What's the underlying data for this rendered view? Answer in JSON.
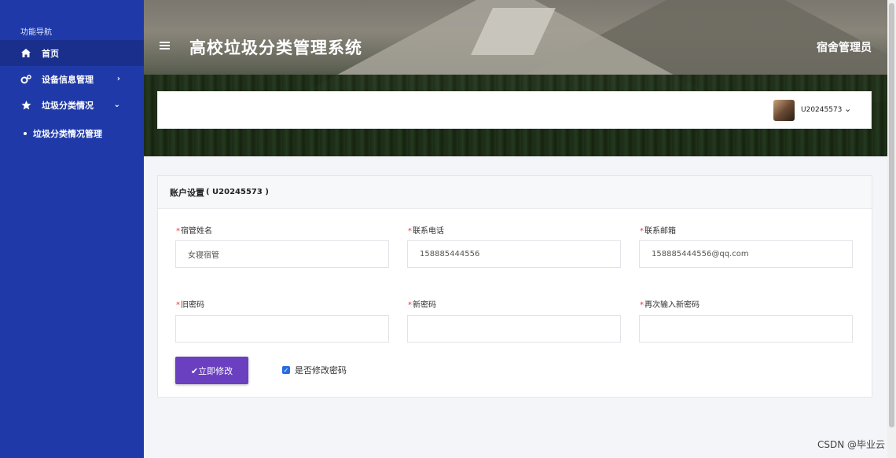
{
  "sidebar": {
    "heading": "功能导航",
    "items": [
      {
        "label": "首页",
        "icon": "home-icon"
      },
      {
        "label": "设备信息管理",
        "icon": "gears-icon"
      },
      {
        "label": "垃圾分类情况",
        "icon": "star-icon"
      }
    ],
    "sub_item": "垃圾分类情况管理"
  },
  "header": {
    "title": "高校垃圾分类管理系统",
    "role": "宿舍管理员",
    "username": "U20245573"
  },
  "form": {
    "title": "账户设置",
    "title_uid": "( U20245573 )",
    "name_label": "宿管姓名",
    "name_value": "女寝宿管",
    "phone_label": "联系电话",
    "phone_value": "158885444556",
    "email_label": "联系邮箱",
    "email_value": "158885444556@qq.com",
    "old_pw_label": "旧密码",
    "new_pw_label": "新密码",
    "confirm_pw_label": "再次输入新密码",
    "submit_label": "✔立即修改",
    "change_pw_label": "是否修改密码"
  },
  "watermark": "CSDN @毕业云",
  "colors": {
    "sidebar": "#1f3aa8",
    "accent": "#6a3fc0",
    "required": "#e33333"
  }
}
